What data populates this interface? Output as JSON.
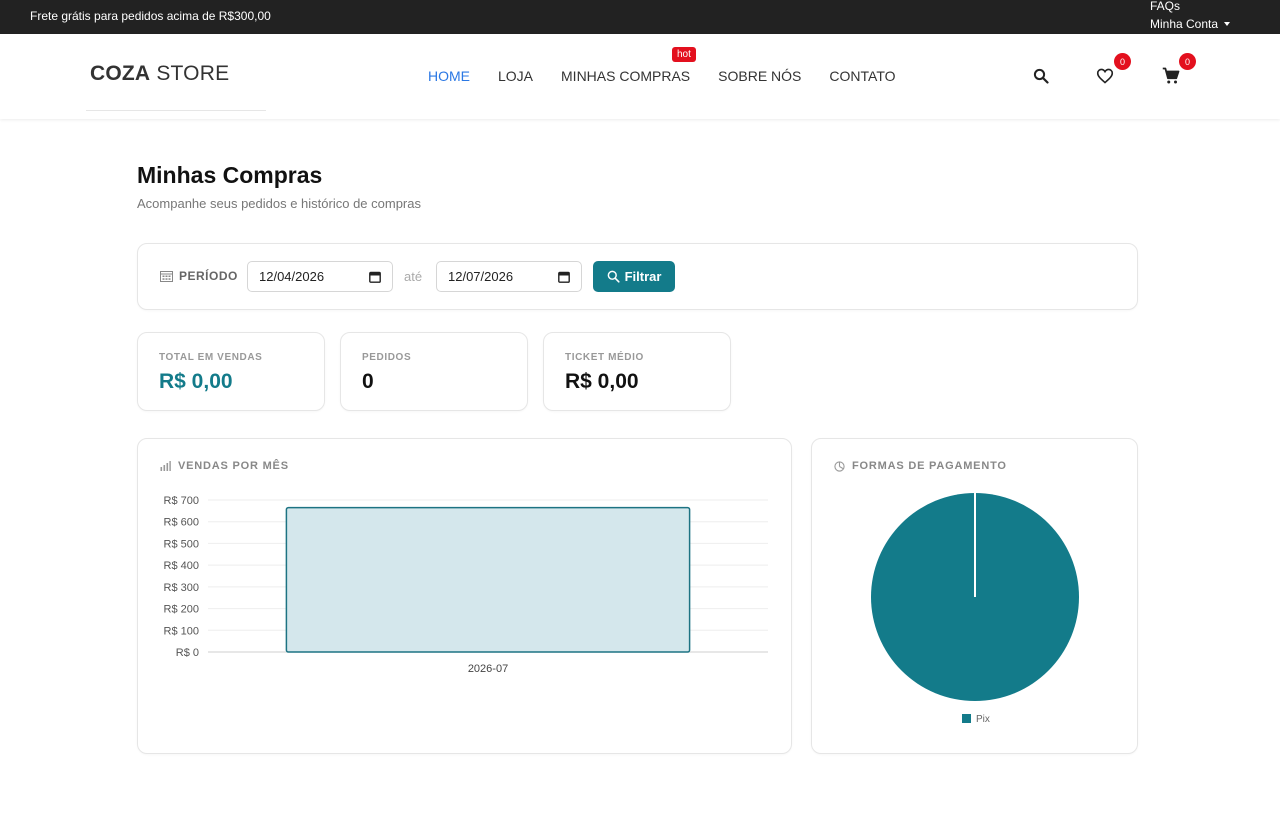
{
  "topbar": {
    "promo": "Frete grátis para pedidos acima de R$300,00",
    "faqs": "FAQs",
    "account": "Minha Conta"
  },
  "header": {
    "logo_bold": "COZA",
    "logo_light": " STORE",
    "nav": [
      {
        "label": "HOME",
        "active": true
      },
      {
        "label": "LOJA",
        "active": false
      },
      {
        "label": "MINHAS COMPRAS",
        "active": false
      },
      {
        "label": "SOBRE NÓS",
        "active": false
      },
      {
        "label": "CONTATO",
        "active": false
      }
    ],
    "hot_badge": "hot",
    "wishlist_count": "0",
    "cart_count": "0",
    "icons": [
      "search-icon",
      "heart-icon",
      "cart-icon"
    ]
  },
  "page": {
    "title": "Minhas Compras",
    "subtitle": "Acompanhe seus pedidos e histórico de compras"
  },
  "filter": {
    "label": "PERÍODO",
    "start_date": "12/04/2026",
    "separator": "até",
    "end_date": "12/07/2026",
    "button": "Filtrar"
  },
  "stats": [
    {
      "label": "TOTAL EM VENDAS",
      "value": "R$ 0,00"
    },
    {
      "label": "PEDIDOS",
      "value": "0"
    },
    {
      "label": "TICKET MÉDIO",
      "value": "R$ 0,00"
    }
  ],
  "panels": {
    "sales_title": "VENDAS POR MÊS",
    "payments_title": "FORMAS DE PAGAMENTO"
  },
  "colors": {
    "accent": "#137b8a",
    "nav_active": "#2b78e4",
    "badge": "#e3101e",
    "bar_fill": "#d4e7ec",
    "bar_stroke": "#1d7383"
  },
  "chart_data": [
    {
      "type": "bar",
      "title": "VENDAS POR MÊS",
      "categories": [
        "2026-07"
      ],
      "values": [
        665
      ],
      "ylim": [
        0,
        700
      ],
      "yticks": [
        0,
        100,
        200,
        300,
        400,
        500,
        600,
        700
      ],
      "ytick_labels": [
        "R$ 0",
        "R$ 100",
        "R$ 200",
        "R$ 300",
        "R$ 400",
        "R$ 500",
        "R$ 600",
        "R$ 700"
      ],
      "grid": true
    },
    {
      "type": "pie",
      "title": "FORMAS DE PAGAMENTO",
      "labels": [
        "Pix"
      ],
      "values": [
        100
      ],
      "legend": "bottom"
    }
  ]
}
